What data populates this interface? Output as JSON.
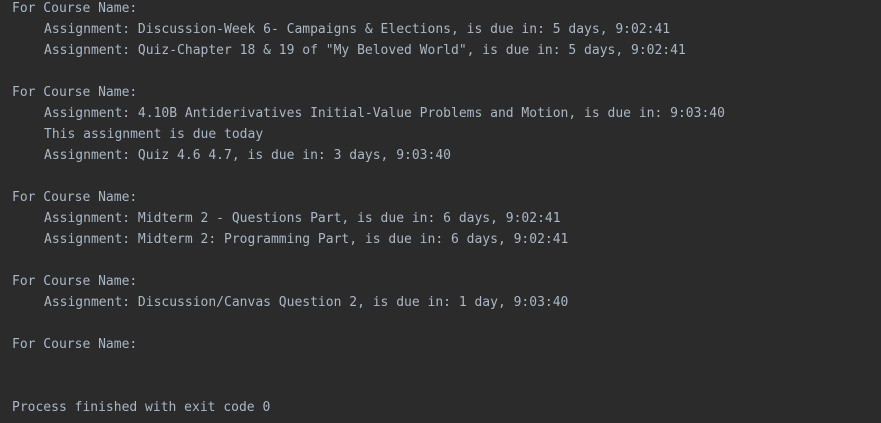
{
  "console": {
    "lines": [
      {
        "text": "For Course Name:",
        "indent": false
      },
      {
        "text": "Assignment: Discussion-Week 6- Campaigns & Elections, is due in: 5 days, 9:02:41",
        "indent": true
      },
      {
        "text": "Assignment: Quiz-Chapter 18 & 19 of \"My Beloved World\", is due in: 5 days, 9:02:41",
        "indent": true
      },
      {
        "text": "",
        "indent": false
      },
      {
        "text": "For Course Name:",
        "indent": false
      },
      {
        "text": "Assignment: 4.10B Antiderivatives Initial-Value Problems and Motion, is due in: 9:03:40",
        "indent": true
      },
      {
        "text": "This assignment is due today",
        "indent": true
      },
      {
        "text": "Assignment: Quiz 4.6 4.7, is due in: 3 days, 9:03:40",
        "indent": true
      },
      {
        "text": "",
        "indent": false
      },
      {
        "text": "For Course Name:",
        "indent": false
      },
      {
        "text": "Assignment: Midterm 2 - Questions Part, is due in: 6 days, 9:02:41",
        "indent": true
      },
      {
        "text": "Assignment: Midterm 2: Programming Part, is due in: 6 days, 9:02:41",
        "indent": true
      },
      {
        "text": "",
        "indent": false
      },
      {
        "text": "For Course Name:",
        "indent": false
      },
      {
        "text": "Assignment: Discussion/Canvas Question 2, is due in: 1 day, 9:03:40",
        "indent": true
      },
      {
        "text": "",
        "indent": false
      },
      {
        "text": "For Course Name:",
        "indent": false
      },
      {
        "text": "",
        "indent": false
      },
      {
        "text": "",
        "indent": false
      },
      {
        "text": "Process finished with exit code 0",
        "indent": false
      }
    ]
  },
  "colors": {
    "background": "#2b2b2b",
    "text": "#a9b7c6"
  }
}
